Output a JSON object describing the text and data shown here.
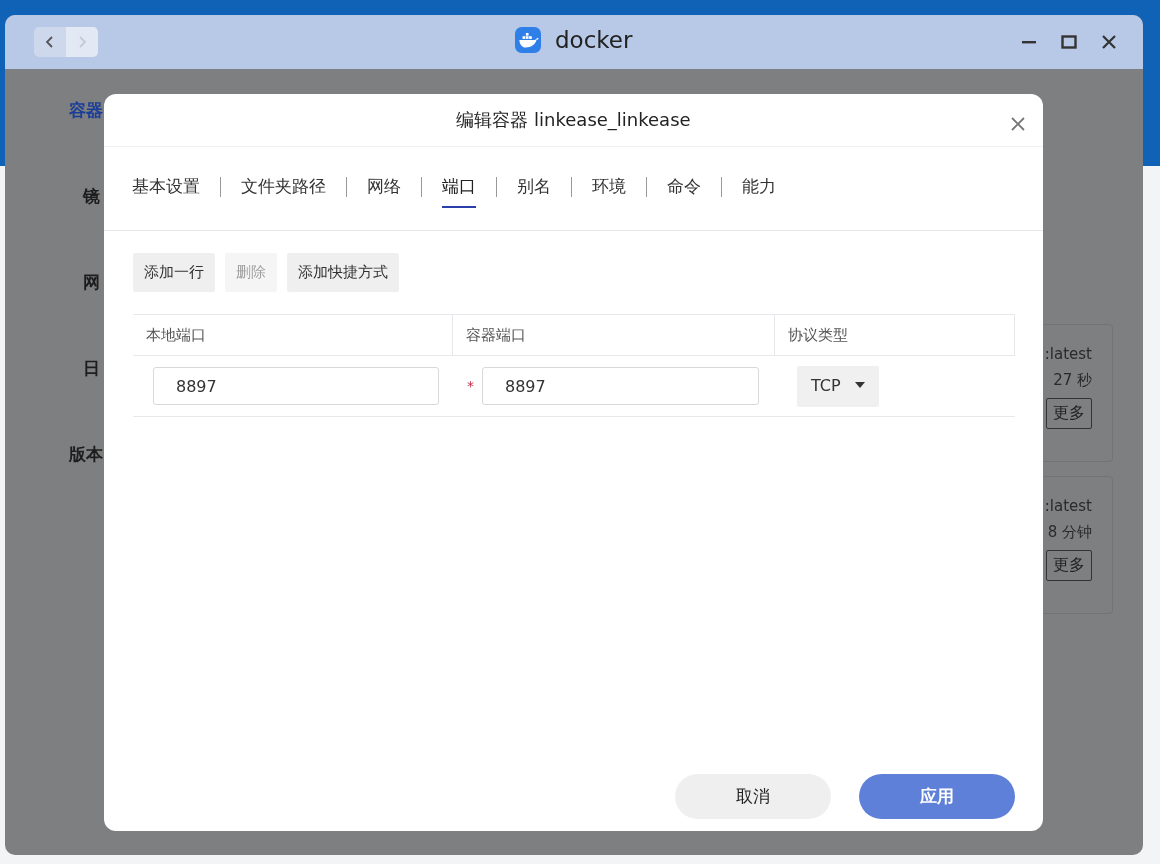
{
  "window": {
    "title": "docker",
    "nav": [
      {
        "kind": "back",
        "disabled": false
      },
      {
        "kind": "forward",
        "disabled": true
      }
    ]
  },
  "background": {
    "sidebar": [
      {
        "label": "容器",
        "selected": true
      },
      {
        "label": "镜",
        "selected": false
      },
      {
        "label": "网",
        "selected": false
      },
      {
        "label": "日",
        "selected": false
      },
      {
        "label": "版本",
        "selected": false
      }
    ],
    "cards": [
      {
        "image": ":latest",
        "uptime": "27 秒",
        "button": "更多"
      },
      {
        "image": ":latest",
        "uptime": "8 分钟",
        "button": "更多"
      }
    ]
  },
  "dialog": {
    "title": "编辑容器 linkease_linkease",
    "tabs": [
      {
        "label": "基本设置",
        "selected": false
      },
      {
        "label": "文件夹路径",
        "selected": false
      },
      {
        "label": "网络",
        "selected": false
      },
      {
        "label": "端口",
        "selected": true
      },
      {
        "label": "别名",
        "selected": false
      },
      {
        "label": "环境",
        "selected": false
      },
      {
        "label": "命令",
        "selected": false
      },
      {
        "label": "能力",
        "selected": false
      }
    ],
    "toolbar": [
      {
        "label": "添加一行",
        "disabled": false
      },
      {
        "label": "删除",
        "disabled": true
      },
      {
        "label": "添加快捷方式",
        "disabled": false
      }
    ],
    "table": {
      "columns": [
        "本地端口",
        "容器端口",
        "协议类型"
      ],
      "rows": [
        {
          "local_port": "8897",
          "required_mark": "*",
          "container_port": "8897",
          "protocol": "TCP"
        }
      ]
    },
    "buttons": [
      {
        "label": "取消",
        "kind": "secondary"
      },
      {
        "label": "应用",
        "kind": "primary"
      }
    ]
  }
}
